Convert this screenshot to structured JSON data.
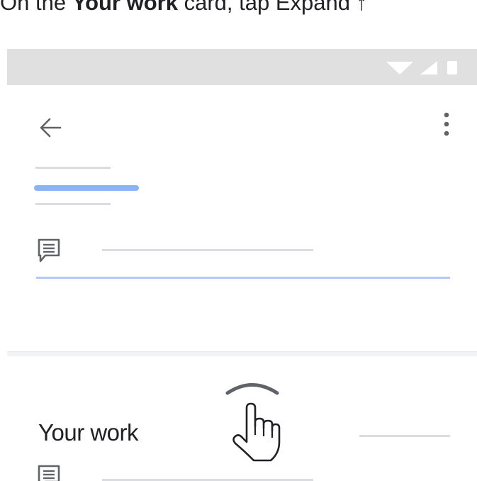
{
  "caption": {
    "prefix": "On the ",
    "card_name": "Your work",
    "middle": " card, tap Expand ",
    "arrow": "↑"
  },
  "icons": {
    "wifi": "wifi-icon",
    "signal": "signal-icon",
    "battery": "battery-icon",
    "back": "arrow-back-icon",
    "more": "more-vert-icon",
    "note": "note-icon",
    "expand": "chevron-up-icon",
    "cursor": "hand-pointer-icon"
  },
  "card": {
    "title": "Your work"
  },
  "colors": {
    "accent_blue": "#8ab4f8",
    "light_blue": "#aecbfa",
    "statusbar": "#e0e0e0",
    "placeholder_gray": "#dadce0"
  }
}
